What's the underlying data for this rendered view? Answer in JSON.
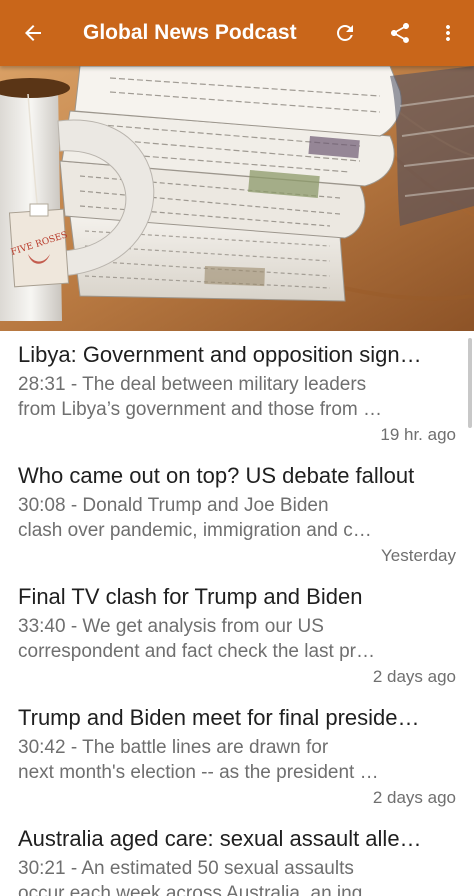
{
  "toolbar": {
    "title": "Global News Podcast",
    "back_icon": "arrow-back-icon",
    "refresh_icon": "refresh-icon",
    "share_icon": "share-icon",
    "menu_icon": "more-vert-icon",
    "color": "#c9661a"
  },
  "hero": {
    "image": "newspapers-and-tea-mug",
    "tea_tag_text": "FIVE ROSES"
  },
  "episodes": [
    {
      "title": "Libya: Government and opposition sign…",
      "desc_line1": "28:31 - The deal between military leaders",
      "desc_line2": "from Libya’s government and those from …",
      "date": "19 hr. ago"
    },
    {
      "title": "Who came out on top? US debate fallout",
      "desc_line1": "30:08 - Donald Trump and Joe Biden",
      "desc_line2": "clash over pandemic, immigration and c…",
      "date": "Yesterday"
    },
    {
      "title": "Final TV clash for Trump and Biden",
      "desc_line1": "33:40 - We get analysis from our US",
      "desc_line2": "correspondent and fact check the last pr…",
      "date": "2 days ago"
    },
    {
      "title": "Trump and Biden meet for final preside…",
      "desc_line1": "30:42 - The battle lines are drawn for",
      "desc_line2": "next month's election -- as the president …",
      "date": "2 days ago"
    },
    {
      "title": "Australia aged care: sexual assault alle…",
      "desc_line1": "30:21 - An estimated 50 sexual assaults",
      "desc_line2": "occur each week across Australia, an ing…",
      "date": ""
    }
  ]
}
